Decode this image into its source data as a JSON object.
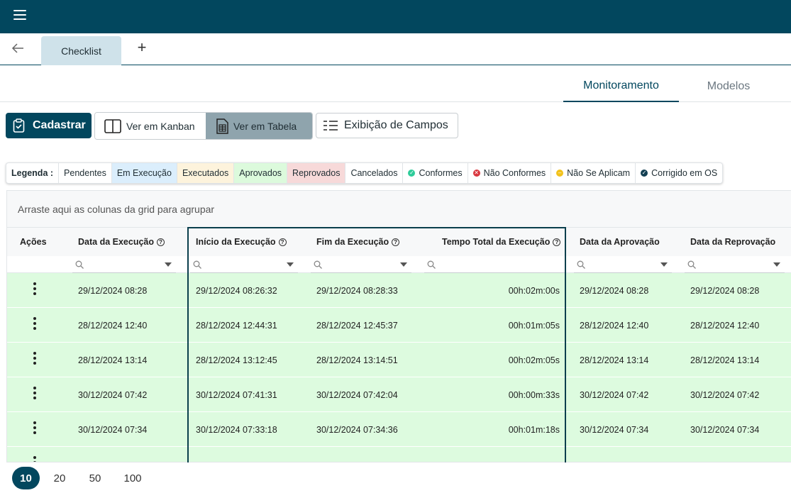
{
  "tabs": {
    "active": "Checklist"
  },
  "view_tabs": {
    "monitoramento": "Monitoramento",
    "modelos": "Modelos"
  },
  "toolbar": {
    "cadastrar": "Cadastrar",
    "ver_kanban": "Ver em Kanban",
    "ver_tabela": "Ver em Tabela",
    "exibicao_campos": "Exibição de Campos"
  },
  "legend": {
    "title": "Legenda :",
    "items": [
      {
        "label": "Pendentes",
        "bg": "#ffffff"
      },
      {
        "label": "Em Execução",
        "bg": "#dbeefc"
      },
      {
        "label": "Executados",
        "bg": "#fdf3dc"
      },
      {
        "label": "Aprovados",
        "bg": "#dcfadc"
      },
      {
        "label": "Reprovados",
        "bg": "#f7d9d9"
      },
      {
        "label": "Cancelados",
        "bg": "#ffffff"
      }
    ],
    "status": [
      {
        "label": "Conformes",
        "color": "#2ecc9a",
        "icon": "check-icon"
      },
      {
        "label": "Não Conformes",
        "color": "#d9363e",
        "icon": "x-icon"
      },
      {
        "label": "Não Se Aplicam",
        "color": "#f2c21b",
        "icon": "minus-icon"
      },
      {
        "label": "Corrigido em OS",
        "color": "#123f52",
        "icon": "check-icon"
      }
    ]
  },
  "grid": {
    "group_panel": "Arraste aqui as colunas da grid para agrupar",
    "columns": {
      "acoes": "Ações",
      "data_execucao": "Data da Execução",
      "inicio_execucao": "Início da Execução",
      "fim_execucao": "Fim da Execução",
      "tempo_total": "Tempo Total da Execução",
      "data_aprovacao": "Data da Aprovação",
      "data_reprovacao": "Data da Reprovação"
    },
    "rows": [
      {
        "data_execucao": "29/12/2024 08:28",
        "inicio": "29/12/2024 08:26:32",
        "fim": "29/12/2024 08:28:33",
        "tempo": "00h:02m:00s",
        "aprovacao": "29/12/2024 08:28",
        "reprovacao": "29/12/2024 08:28"
      },
      {
        "data_execucao": "28/12/2024 12:40",
        "inicio": "28/12/2024 12:44:31",
        "fim": "28/12/2024 12:45:37",
        "tempo": "00h:01m:05s",
        "aprovacao": "28/12/2024 12:40",
        "reprovacao": "28/12/2024 12:40"
      },
      {
        "data_execucao": "28/12/2024 13:14",
        "inicio": "28/12/2024 13:12:45",
        "fim": "28/12/2024 13:14:51",
        "tempo": "00h:02m:05s",
        "aprovacao": "28/12/2024 13:14",
        "reprovacao": "28/12/2024 13:14"
      },
      {
        "data_execucao": "30/12/2024 07:42",
        "inicio": "30/12/2024 07:41:31",
        "fim": "30/12/2024 07:42:04",
        "tempo": "00h:00m:33s",
        "aprovacao": "30/12/2024 07:42",
        "reprovacao": "30/12/2024 07:42"
      },
      {
        "data_execucao": "30/12/2024 07:34",
        "inicio": "30/12/2024 07:33:18",
        "fim": "30/12/2024 07:34:36",
        "tempo": "00h:01m:18s",
        "aprovacao": "30/12/2024 07:34",
        "reprovacao": "30/12/2024 07:34"
      }
    ]
  },
  "pager": {
    "sizes": [
      "10",
      "20",
      "50",
      "100"
    ],
    "active": "10"
  }
}
